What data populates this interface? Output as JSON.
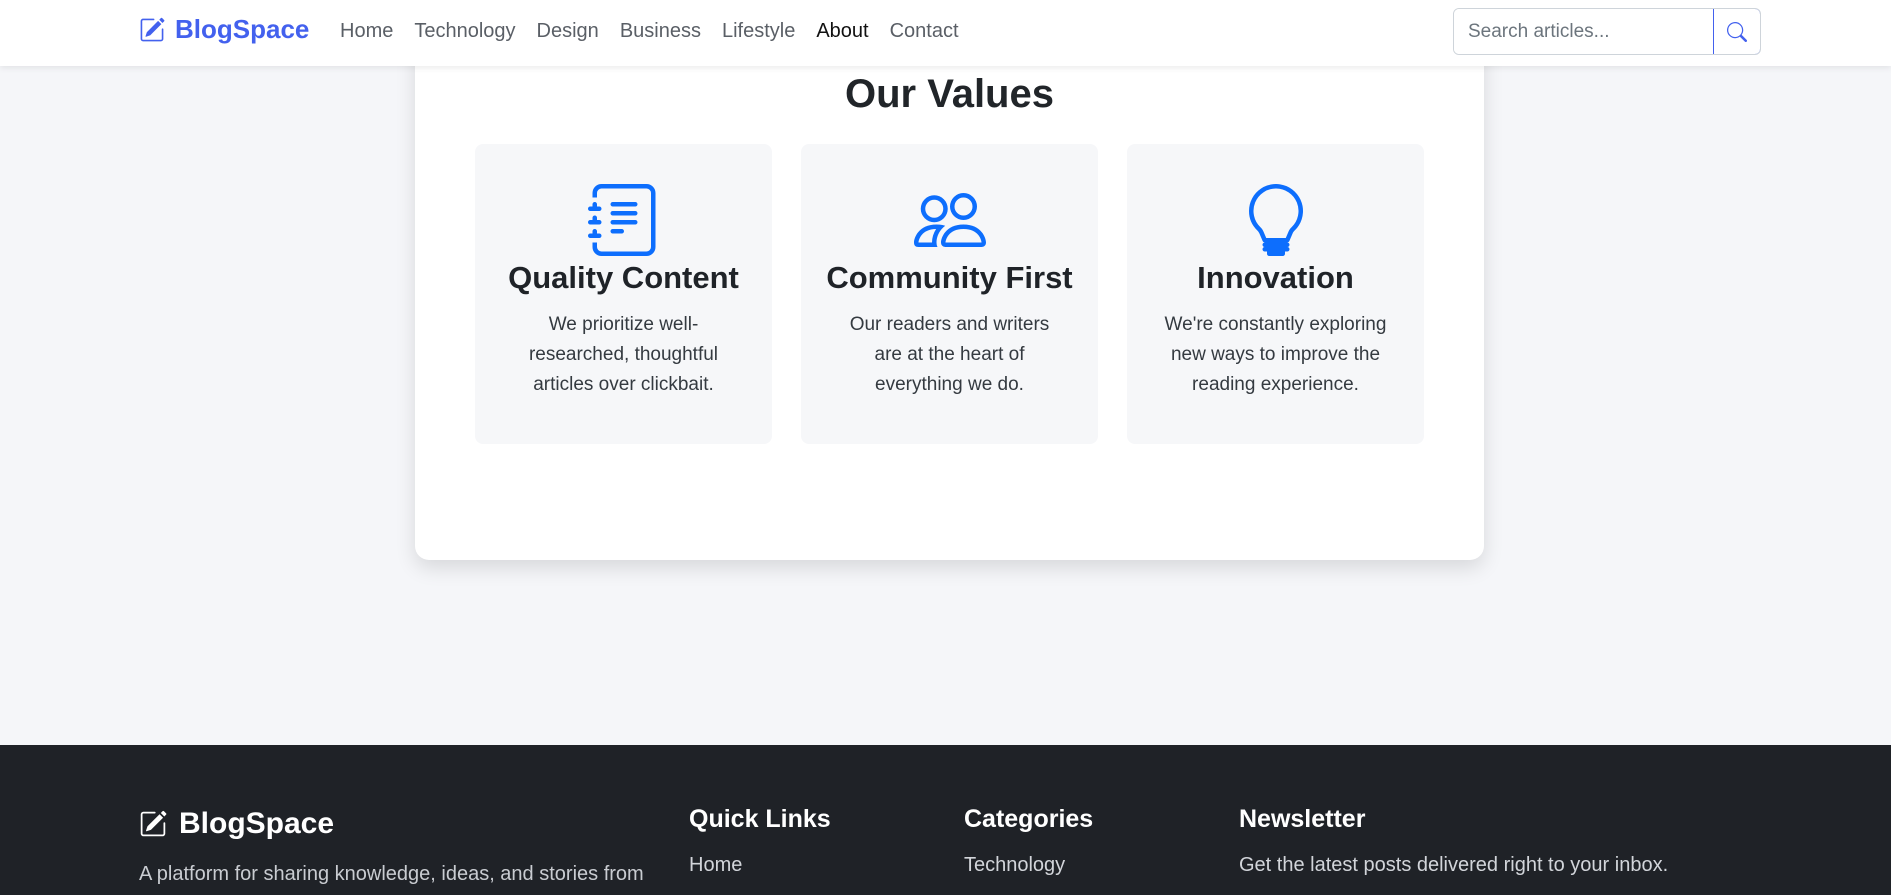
{
  "navbar": {
    "brand": "BlogSpace",
    "links": [
      "Home",
      "Technology",
      "Design",
      "Business",
      "Lifestyle",
      "About",
      "Contact"
    ],
    "active_link": "About",
    "search_placeholder": "Search articles..."
  },
  "values": {
    "title": "Our Values",
    "items": [
      {
        "title": "Quality Content",
        "text": "We prioritize well-researched, thoughtful articles over clickbait.",
        "icon": "journal-text-icon"
      },
      {
        "title": "Community First",
        "text": "Our readers and writers are at the heart of everything we do.",
        "icon": "people-icon"
      },
      {
        "title": "Innovation",
        "text": "We're constantly exploring new ways to improve the reading experience.",
        "icon": "lightbulb-icon"
      }
    ]
  },
  "footer": {
    "brand": "BlogSpace",
    "description": "A platform for sharing knowledge, ideas, and stories from",
    "quick_links": {
      "title": "Quick Links",
      "first": "Home"
    },
    "categories": {
      "title": "Categories",
      "first": "Technology"
    },
    "newsletter": {
      "title": "Newsletter",
      "text": "Get the latest posts delivered right to your inbox."
    }
  },
  "colors": {
    "brand": "#4361ee",
    "icon_blue": "#0d6efd",
    "footer_bg": "#1f2227",
    "page_bg": "#f5f6f9"
  }
}
